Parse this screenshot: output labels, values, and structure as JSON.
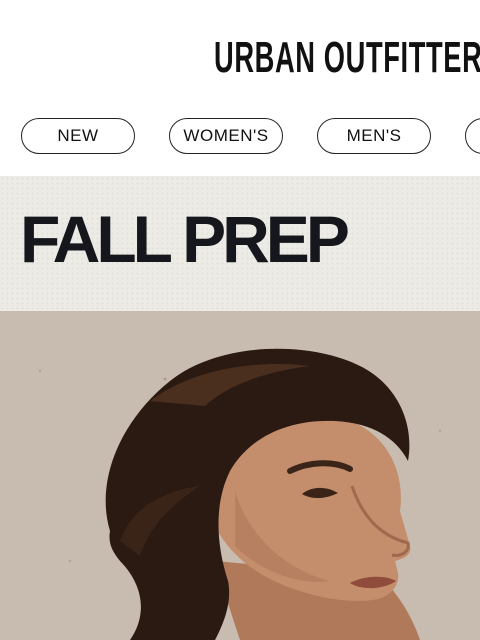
{
  "header": {
    "logo_text": "URBAN OUTFITTERS"
  },
  "nav": {
    "items": [
      {
        "label": "NEW"
      },
      {
        "label": "WOMEN'S"
      },
      {
        "label": "MEN'S"
      },
      {
        "label": ""
      }
    ]
  },
  "banner": {
    "headline": "FALL PREP"
  },
  "colors": {
    "banner_bg": "#ecebe6",
    "headline": "#15171c",
    "hero_bg": "#cbbfb5"
  }
}
